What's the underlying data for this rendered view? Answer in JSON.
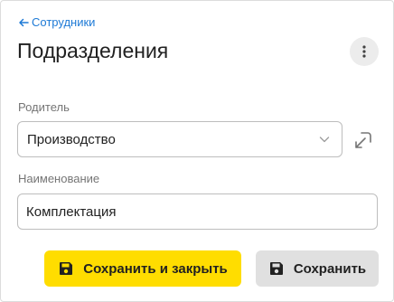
{
  "header": {
    "back_label": "Сотрудники",
    "title": "Подразделения"
  },
  "form": {
    "parent_label": "Родитель",
    "parent_value": "Производство",
    "name_label": "Наименование",
    "name_value": "Комплектация"
  },
  "actions": {
    "save_close_label": "Сохранить и закрыть",
    "save_label": "Сохранить"
  },
  "icons": {
    "back": "arrow-left-icon",
    "more": "more-vertical-icon",
    "chevron": "chevron-down-icon",
    "open": "open-link-icon",
    "save": "floppy-disk-icon"
  },
  "colors": {
    "link": "#1e7ad6",
    "primary_button": "#ffdd00",
    "secondary_button": "#e0e0e0"
  }
}
